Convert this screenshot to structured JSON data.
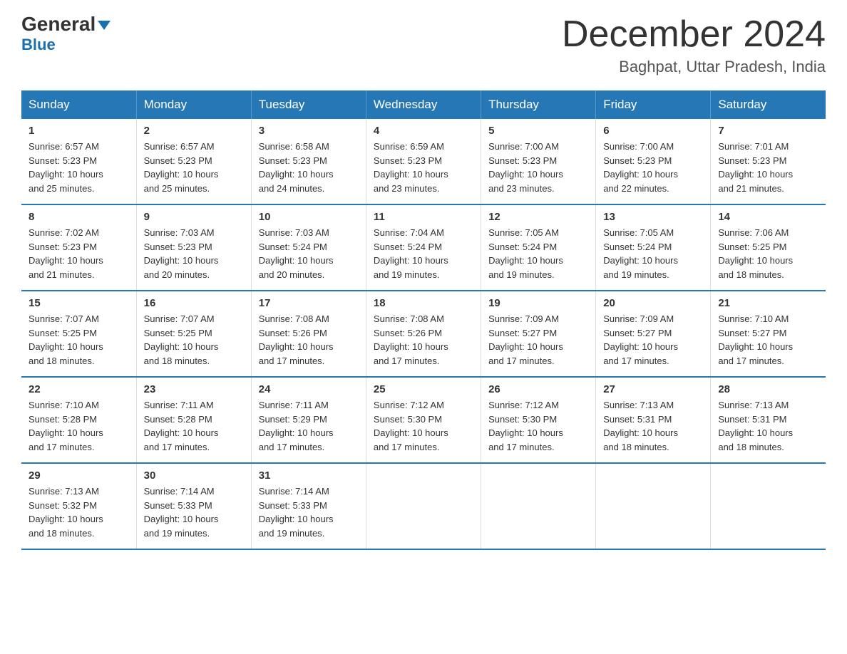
{
  "header": {
    "logo_general": "General",
    "logo_blue": "Blue",
    "month_title": "December 2024",
    "location": "Baghpat, Uttar Pradesh, India"
  },
  "days_of_week": [
    "Sunday",
    "Monday",
    "Tuesday",
    "Wednesday",
    "Thursday",
    "Friday",
    "Saturday"
  ],
  "weeks": [
    [
      {
        "day": "1",
        "sunrise": "6:57 AM",
        "sunset": "5:23 PM",
        "daylight": "10 hours and 25 minutes."
      },
      {
        "day": "2",
        "sunrise": "6:57 AM",
        "sunset": "5:23 PM",
        "daylight": "10 hours and 25 minutes."
      },
      {
        "day": "3",
        "sunrise": "6:58 AM",
        "sunset": "5:23 PM",
        "daylight": "10 hours and 24 minutes."
      },
      {
        "day": "4",
        "sunrise": "6:59 AM",
        "sunset": "5:23 PM",
        "daylight": "10 hours and 23 minutes."
      },
      {
        "day": "5",
        "sunrise": "7:00 AM",
        "sunset": "5:23 PM",
        "daylight": "10 hours and 23 minutes."
      },
      {
        "day": "6",
        "sunrise": "7:00 AM",
        "sunset": "5:23 PM",
        "daylight": "10 hours and 22 minutes."
      },
      {
        "day": "7",
        "sunrise": "7:01 AM",
        "sunset": "5:23 PM",
        "daylight": "10 hours and 21 minutes."
      }
    ],
    [
      {
        "day": "8",
        "sunrise": "7:02 AM",
        "sunset": "5:23 PM",
        "daylight": "10 hours and 21 minutes."
      },
      {
        "day": "9",
        "sunrise": "7:03 AM",
        "sunset": "5:23 PM",
        "daylight": "10 hours and 20 minutes."
      },
      {
        "day": "10",
        "sunrise": "7:03 AM",
        "sunset": "5:24 PM",
        "daylight": "10 hours and 20 minutes."
      },
      {
        "day": "11",
        "sunrise": "7:04 AM",
        "sunset": "5:24 PM",
        "daylight": "10 hours and 19 minutes."
      },
      {
        "day": "12",
        "sunrise": "7:05 AM",
        "sunset": "5:24 PM",
        "daylight": "10 hours and 19 minutes."
      },
      {
        "day": "13",
        "sunrise": "7:05 AM",
        "sunset": "5:24 PM",
        "daylight": "10 hours and 19 minutes."
      },
      {
        "day": "14",
        "sunrise": "7:06 AM",
        "sunset": "5:25 PM",
        "daylight": "10 hours and 18 minutes."
      }
    ],
    [
      {
        "day": "15",
        "sunrise": "7:07 AM",
        "sunset": "5:25 PM",
        "daylight": "10 hours and 18 minutes."
      },
      {
        "day": "16",
        "sunrise": "7:07 AM",
        "sunset": "5:25 PM",
        "daylight": "10 hours and 18 minutes."
      },
      {
        "day": "17",
        "sunrise": "7:08 AM",
        "sunset": "5:26 PM",
        "daylight": "10 hours and 17 minutes."
      },
      {
        "day": "18",
        "sunrise": "7:08 AM",
        "sunset": "5:26 PM",
        "daylight": "10 hours and 17 minutes."
      },
      {
        "day": "19",
        "sunrise": "7:09 AM",
        "sunset": "5:27 PM",
        "daylight": "10 hours and 17 minutes."
      },
      {
        "day": "20",
        "sunrise": "7:09 AM",
        "sunset": "5:27 PM",
        "daylight": "10 hours and 17 minutes."
      },
      {
        "day": "21",
        "sunrise": "7:10 AM",
        "sunset": "5:27 PM",
        "daylight": "10 hours and 17 minutes."
      }
    ],
    [
      {
        "day": "22",
        "sunrise": "7:10 AM",
        "sunset": "5:28 PM",
        "daylight": "10 hours and 17 minutes."
      },
      {
        "day": "23",
        "sunrise": "7:11 AM",
        "sunset": "5:28 PM",
        "daylight": "10 hours and 17 minutes."
      },
      {
        "day": "24",
        "sunrise": "7:11 AM",
        "sunset": "5:29 PM",
        "daylight": "10 hours and 17 minutes."
      },
      {
        "day": "25",
        "sunrise": "7:12 AM",
        "sunset": "5:30 PM",
        "daylight": "10 hours and 17 minutes."
      },
      {
        "day": "26",
        "sunrise": "7:12 AM",
        "sunset": "5:30 PM",
        "daylight": "10 hours and 17 minutes."
      },
      {
        "day": "27",
        "sunrise": "7:13 AM",
        "sunset": "5:31 PM",
        "daylight": "10 hours and 18 minutes."
      },
      {
        "day": "28",
        "sunrise": "7:13 AM",
        "sunset": "5:31 PM",
        "daylight": "10 hours and 18 minutes."
      }
    ],
    [
      {
        "day": "29",
        "sunrise": "7:13 AM",
        "sunset": "5:32 PM",
        "daylight": "10 hours and 18 minutes."
      },
      {
        "day": "30",
        "sunrise": "7:14 AM",
        "sunset": "5:33 PM",
        "daylight": "10 hours and 19 minutes."
      },
      {
        "day": "31",
        "sunrise": "7:14 AM",
        "sunset": "5:33 PM",
        "daylight": "10 hours and 19 minutes."
      },
      null,
      null,
      null,
      null
    ]
  ],
  "labels": {
    "sunrise": "Sunrise: ",
    "sunset": "Sunset: ",
    "daylight": "Daylight: "
  }
}
